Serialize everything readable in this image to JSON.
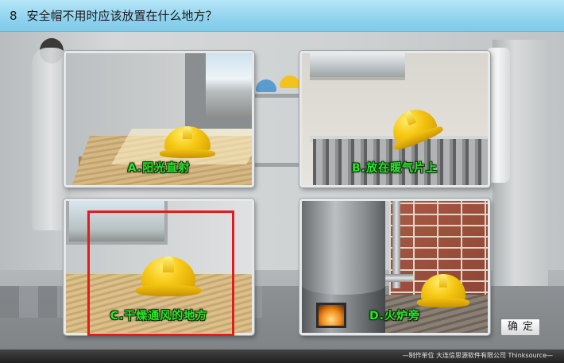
{
  "question": {
    "number": "8",
    "text": "安全帽不用时应该放置在什么地方？"
  },
  "options": [
    {
      "key": "A",
      "label": "A.阳光直射"
    },
    {
      "key": "B",
      "label": "B.放在暖气片上"
    },
    {
      "key": "C",
      "label": "C.干燥通风的地方"
    },
    {
      "key": "D",
      "label": "D.火炉旁"
    }
  ],
  "selected_option": "C",
  "confirm_button": {
    "label": "确定"
  },
  "footer": {
    "text": "—制作单位  大连信思源软件有限公司 Thinksource—"
  },
  "colors": {
    "header_bar": "#8fd3ee",
    "option_label": "#2ee52a",
    "selection_border": "#e21b1b",
    "helmet": "#f7c916"
  }
}
